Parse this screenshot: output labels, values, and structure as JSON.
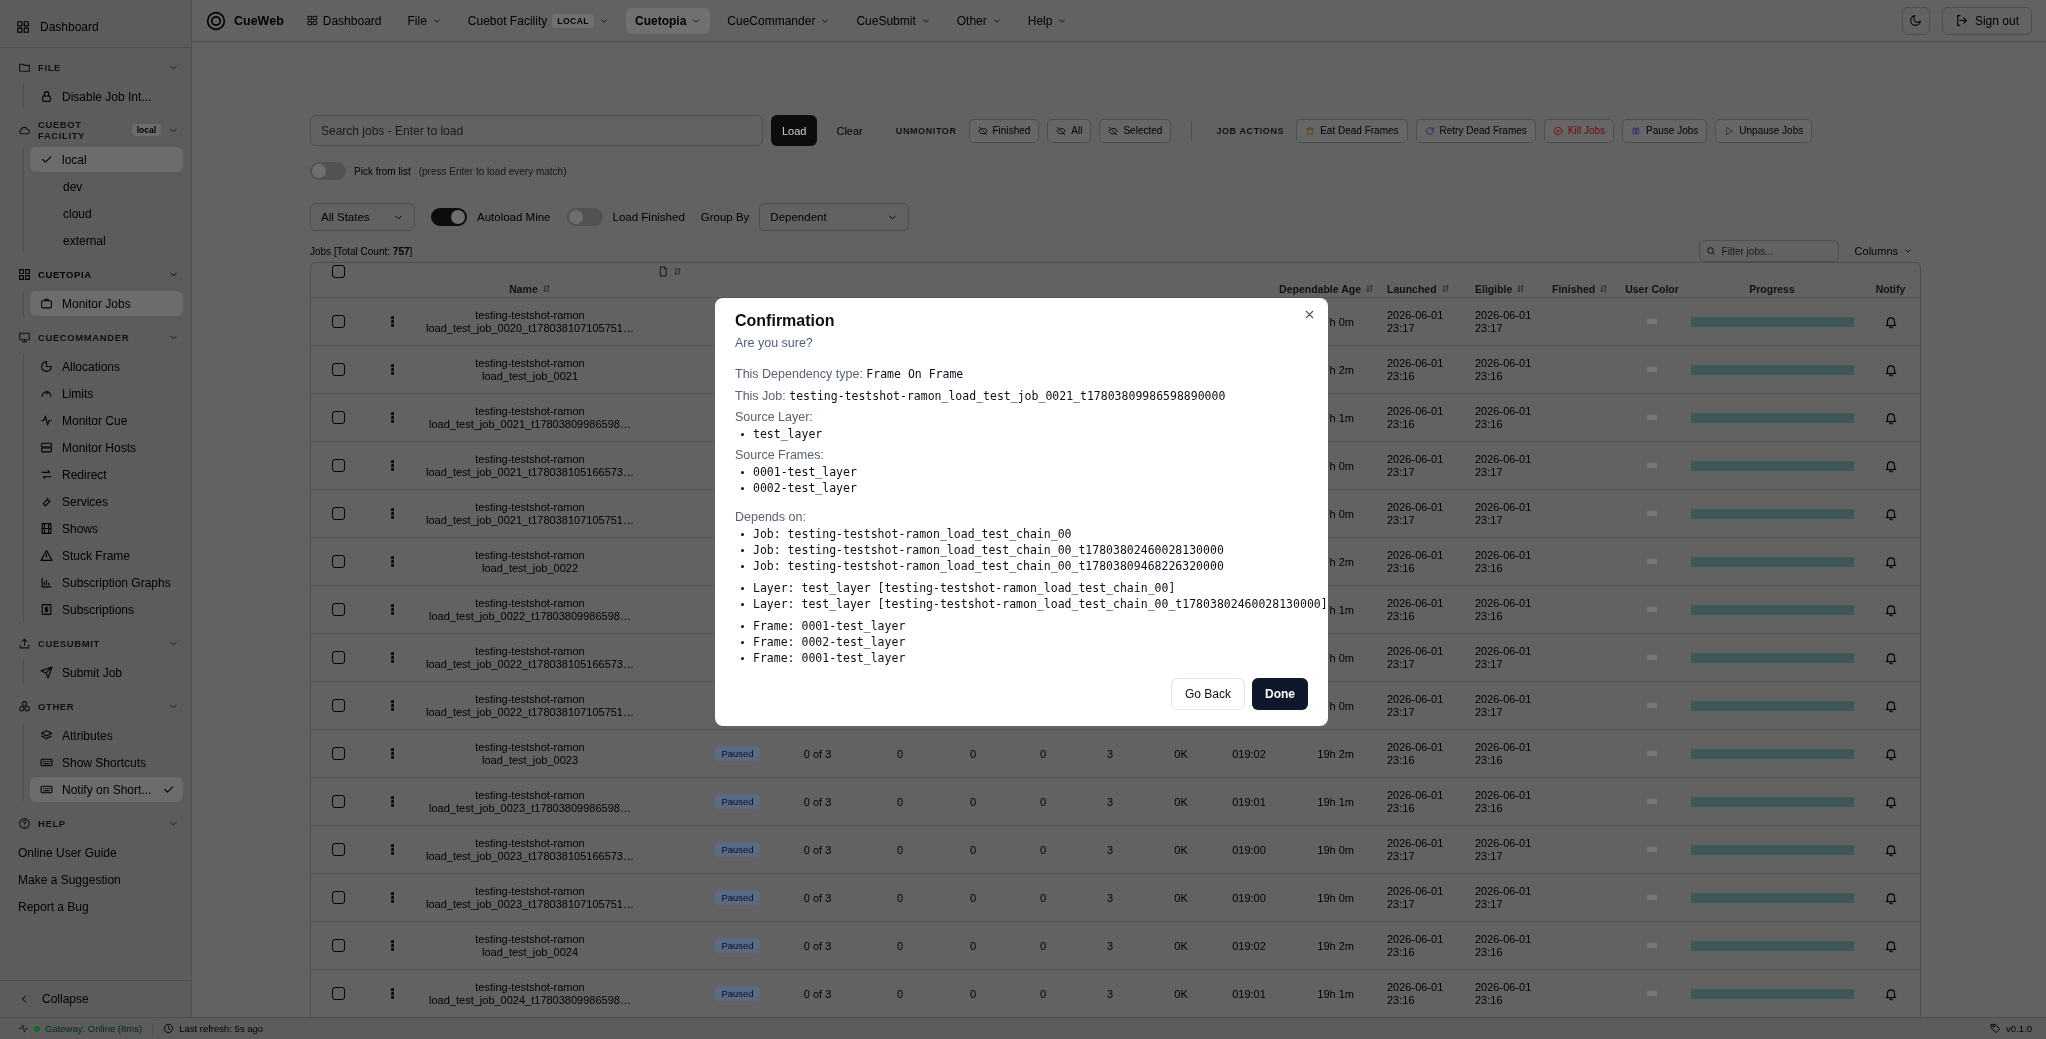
{
  "sidebar": {
    "dashboard": "Dashboard",
    "sections": [
      {
        "title": "FILE",
        "kind": "menu",
        "expanded": true,
        "active": false,
        "items": [
          {
            "label": "Disable Job Int...",
            "selected": false
          }
        ]
      },
      {
        "title": "CUEBOT FACILITY",
        "badge": "local",
        "kind": "facility",
        "expanded": true,
        "active": false,
        "items": [
          {
            "label": "local",
            "selected": true,
            "checked": true
          },
          {
            "label": "dev",
            "selected": false,
            "checked": false
          },
          {
            "label": "cloud",
            "selected": false,
            "checked": false
          },
          {
            "label": "external",
            "selected": false,
            "checked": false
          }
        ]
      },
      {
        "title": "CUETOPIA",
        "kind": "menu",
        "expanded": true,
        "active": true,
        "items": [
          {
            "label": "Monitor Jobs",
            "selected": true
          }
        ]
      },
      {
        "title": "CUECOMMANDER",
        "kind": "menu",
        "expanded": true,
        "active": false,
        "items": [
          {
            "label": "Allocations",
            "selected": false
          },
          {
            "label": "Limits",
            "selected": false
          },
          {
            "label": "Monitor Cue",
            "selected": false
          },
          {
            "label": "Monitor Hosts",
            "selected": false
          },
          {
            "label": "Redirect",
            "selected": false
          },
          {
            "label": "Services",
            "selected": false
          },
          {
            "label": "Shows",
            "selected": false
          },
          {
            "label": "Stuck Frame",
            "selected": false
          },
          {
            "label": "Subscription Graphs",
            "selected": false
          },
          {
            "label": "Subscriptions",
            "selected": false
          }
        ]
      },
      {
        "title": "CUESUBMIT",
        "kind": "menu",
        "expanded": true,
        "active": false,
        "items": [
          {
            "label": "Submit Job",
            "selected": false
          }
        ]
      },
      {
        "title": "OTHER",
        "kind": "menu",
        "expanded": true,
        "active": false,
        "items": [
          {
            "label": "Attributes",
            "selected": false,
            "checked": false
          },
          {
            "label": "Show Shortcuts",
            "selected": false,
            "checked": false
          },
          {
            "label": "Notify on Short...",
            "selected": true,
            "checked": true
          }
        ]
      },
      {
        "title": "HELP",
        "kind": "links",
        "expanded": true,
        "active": false,
        "items": [
          {
            "label": "Online User Guide",
            "selected": false
          },
          {
            "label": "Make a Suggestion",
            "selected": false
          },
          {
            "label": "Report a Bug",
            "selected": false
          }
        ]
      }
    ],
    "collapse": "Collapse"
  },
  "top_nav": {
    "brand": "CueWeb",
    "items": [
      {
        "label": "Dashboard",
        "kind": "link",
        "selected": false
      },
      {
        "label": "File",
        "kind": "menu",
        "selected": false
      },
      {
        "label": "Cuebot Facility",
        "badge": "LOCAL",
        "kind": "menu",
        "selected": false
      },
      {
        "label": "Cuetopia",
        "kind": "menu",
        "selected": true
      },
      {
        "label": "CueCommander",
        "kind": "menu",
        "selected": false
      },
      {
        "label": "CueSubmit",
        "kind": "menu",
        "selected": false
      },
      {
        "label": "Other",
        "kind": "menu",
        "selected": false
      },
      {
        "label": "Help",
        "kind": "menu",
        "selected": false
      }
    ],
    "sign_out": "Sign out"
  },
  "toolbar": {
    "search_placeholder": "Search jobs - Enter to load",
    "load": "Load",
    "clear": "Clear",
    "unmonitor": {
      "label": "UNMONITOR",
      "buttons": [
        "Finished",
        "All",
        "Selected"
      ]
    },
    "job_actions": {
      "label": "JOB ACTIONS",
      "buttons": [
        {
          "label": "Eat Dead Frames",
          "kind": "normal"
        },
        {
          "label": "Retry Dead Frames",
          "kind": "normal"
        },
        {
          "label": "Kill Jobs",
          "kind": "danger"
        },
        {
          "label": "Pause Jobs",
          "kind": "normal"
        },
        {
          "label": "Unpause Jobs",
          "kind": "normal"
        }
      ]
    },
    "pick_from_list": {
      "label": "Pick from list",
      "hint": "(press Enter to load every match)",
      "on": false
    }
  },
  "filters": {
    "state_select": "All States",
    "toggles": [
      {
        "label": "Autoload Mine",
        "on": true
      },
      {
        "label": "Load Finished",
        "on": false
      }
    ],
    "group_by": {
      "label": "Group By",
      "value": "Dependent"
    }
  },
  "jobs_summary": "Jobs [Total Count: **757**]",
  "filter_placeholder": "Filter jobs...",
  "columns_button": "Columns",
  "table": {
    "select_all": false,
    "columns": [
      {
        "label": "Name",
        "sortable": true
      },
      {
        "label": "Dependable Age",
        "sortable": true
      },
      {
        "label": "Launched",
        "sortable": true
      },
      {
        "label": "Eligible",
        "sortable": true
      },
      {
        "label": "Finished",
        "sortable": true
      },
      {
        "label": "User Color",
        "sortable": false
      },
      {
        "label": "Progress",
        "sortable": false
      },
      {
        "label": "Notify",
        "sortable": false
      }
    ],
    "rows": [
      {
        "selected": false,
        "name": [
          "testing-testshot-ramon",
          "load_test_job_0020_t178038107105751…"
        ],
        "column_13": "h 0m",
        "launched": "2026-06-01 23:17",
        "eligible": "2026-06-01 23:17",
        "level": 1
      },
      {
        "selected": false,
        "name": [
          "testing-testshot-ramon",
          "load_test_job_0021"
        ],
        "column_13": "h 2m",
        "launched": "2026-06-01 23:16",
        "eligible": "2026-06-01 23:16",
        "level": 1
      },
      {
        "selected": false,
        "name": [
          "testing-testshot-ramon",
          "load_test_job_0021_t17803809986598…"
        ],
        "column_13": "h 1m",
        "launched": "2026-06-01 23:16",
        "eligible": "2026-06-01 23:16",
        "level": 1
      },
      {
        "selected": false,
        "name": [
          "testing-testshot-ramon",
          "load_test_job_0021_t178038105166573…"
        ],
        "column_13": "h 0m",
        "launched": "2026-06-01 23:17",
        "eligible": "2026-06-01 23:17",
        "level": 1
      },
      {
        "selected": false,
        "name": [
          "testing-testshot-ramon",
          "load_test_job_0021_t178038107105751…"
        ],
        "column_13": "h 0m",
        "launched": "2026-06-01 23:17",
        "eligible": "2026-06-01 23:17",
        "level": 1
      },
      {
        "selected": false,
        "name": [
          "testing-testshot-ramon",
          "load_test_job_0022"
        ],
        "column_13": "h 2m",
        "launched": "2026-06-01 23:16",
        "eligible": "2026-06-01 23:16",
        "level": 1
      },
      {
        "selected": false,
        "name": [
          "testing-testshot-ramon",
          "load_test_job_0022_t17803809986598…"
        ],
        "column_13": "h 1m",
        "launched": "2026-06-01 23:16",
        "eligible": "2026-06-01 23:16",
        "level": 1
      },
      {
        "selected": false,
        "name": [
          "testing-testshot-ramon",
          "load_test_job_0022_t178038105166573…"
        ],
        "column_13": "h 0m",
        "launched": "2026-06-01 23:17",
        "eligible": "2026-06-01 23:17",
        "level": 1
      },
      {
        "selected": false,
        "name": [
          "testing-testshot-ramon",
          "load_test_job_0022_t178038107105751…"
        ],
        "column_13": "h 0m",
        "launched": "2026-06-01 23:17",
        "eligible": "2026-06-01 23:17",
        "level": 1
      },
      {
        "selected": false,
        "name": [
          "testing-testshot-ramon",
          "load_test_job_0023"
        ],
        "column_5": "Paused",
        "column_6": "0 of 3",
        "column_7": "0",
        "column_8": "0",
        "column_9": "0",
        "column_10": "3",
        "column_11": "0K",
        "column_12": "019:02",
        "column_13": "19h 2m",
        "launched": "2026-06-01 23:16",
        "eligible": "2026-06-01 23:16",
        "level": 1
      },
      {
        "selected": false,
        "name": [
          "testing-testshot-ramon",
          "load_test_job_0023_t17803809986598…"
        ],
        "column_5": "Paused",
        "column_6": "0 of 3",
        "column_7": "0",
        "column_8": "0",
        "column_9": "0",
        "column_10": "3",
        "column_11": "0K",
        "column_12": "019:01",
        "column_13": "19h 1m",
        "launched": "2026-06-01 23:16",
        "eligible": "2026-06-01 23:16",
        "level": 1
      },
      {
        "selected": false,
        "name": [
          "testing-testshot-ramon",
          "load_test_job_0023_t178038105166573…"
        ],
        "column_5": "Paused",
        "column_6": "0 of 3",
        "column_7": "0",
        "column_8": "0",
        "column_9": "0",
        "column_10": "3",
        "column_11": "0K",
        "column_12": "019:00",
        "column_13": "19h 0m",
        "launched": "2026-06-01 23:17",
        "eligible": "2026-06-01 23:17",
        "level": 1
      },
      {
        "selected": false,
        "name": [
          "testing-testshot-ramon",
          "load_test_job_0023_t178038107105751…"
        ],
        "column_5": "Paused",
        "column_6": "0 of 3",
        "column_7": "0",
        "column_8": "0",
        "column_9": "0",
        "column_10": "3",
        "column_11": "0K",
        "column_12": "019:00",
        "column_13": "19h 0m",
        "launched": "2026-06-01 23:17",
        "eligible": "2026-06-01 23:17",
        "level": 1
      },
      {
        "selected": false,
        "name": [
          "testing-testshot-ramon",
          "load_test_job_0024"
        ],
        "column_5": "Paused",
        "column_6": "0 of 3",
        "column_7": "0",
        "column_8": "0",
        "column_9": "0",
        "column_10": "3",
        "column_11": "0K",
        "column_12": "019:02",
        "column_13": "19h 2m",
        "launched": "2026-06-01 23:16",
        "eligible": "2026-06-01 23:16",
        "level": 1
      },
      {
        "selected": false,
        "name": [
          "testing-testshot-ramon",
          "load_test_job_0024_t17803809986598…"
        ],
        "column_5": "Paused",
        "column_6": "0 of 3",
        "column_7": "0",
        "column_8": "0",
        "column_9": "0",
        "column_10": "3",
        "column_11": "0K",
        "column_12": "019:01",
        "column_13": "19h 1m",
        "launched": "2026-06-01 23:16",
        "eligible": "2026-06-01 23:16",
        "level": 1
      }
    ]
  },
  "dialog": {
    "title": "Confirmation",
    "subtitle": "Are you sure?",
    "fields": [
      {
        "label": "This Dependency type:",
        "value": "Frame On Frame"
      },
      {
        "label": "This Job:",
        "value": "testing-testshot-ramon_load_test_job_0021_t17803809986598890000"
      }
    ],
    "lists": [
      {
        "label": "Source Layer:",
        "groups": [
          [
            "test_layer"
          ]
        ]
      },
      {
        "label": "Source Frames:",
        "groups": [
          [
            "0001-test_layer",
            "0002-test_layer"
          ]
        ]
      },
      {
        "label": "Depends on:",
        "groups": [
          [
            "Job: testing-testshot-ramon_load_test_chain_00",
            "Job: testing-testshot-ramon_load_test_chain_00_t17803802460028130000",
            "Job: testing-testshot-ramon_load_test_chain_00_t17803809468226320000"
          ],
          [
            "Layer: test_layer [testing-testshot-ramon_load_test_chain_00]",
            "Layer: test_layer [testing-testshot-ramon_load_test_chain_00_t17803802460028130000]"
          ],
          [
            "Frame: 0001-test_layer",
            "Frame: 0002-test_layer",
            "Frame: 0001-test_layer"
          ]
        ]
      }
    ],
    "buttons": [
      {
        "label": "Go Back",
        "kind": "secondary"
      },
      {
        "label": "Done",
        "kind": "primary"
      }
    ]
  },
  "status_bar": {
    "gateway": "Gateway: Online (8ms)",
    "online": true,
    "last_refresh": "Last refresh: 5s ago",
    "version": "v0.1.0"
  }
}
